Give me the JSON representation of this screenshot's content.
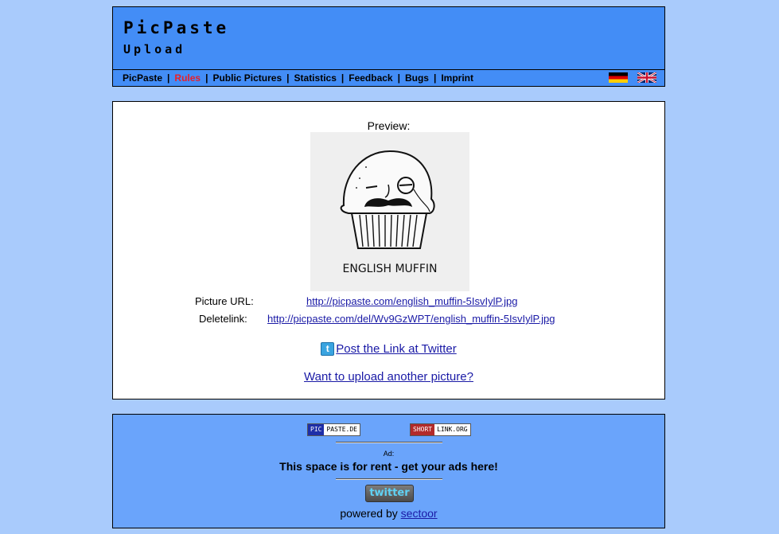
{
  "header": {
    "title": "PicPaste",
    "subtitle": "Upload"
  },
  "nav": {
    "items": [
      {
        "label": "PicPaste"
      },
      {
        "label": "Rules"
      },
      {
        "label": "Public Pictures"
      },
      {
        "label": "Statistics"
      },
      {
        "label": "Feedback"
      },
      {
        "label": "Bugs"
      },
      {
        "label": "Imprint"
      }
    ],
    "active": "Rules",
    "separator": "|"
  },
  "languages": [
    "german-flag-icon",
    "uk-flag-icon"
  ],
  "main": {
    "preview_label": "Preview:",
    "image_caption": "ENGLISH MUFFIN",
    "picture_url_label": "Picture URL:",
    "picture_url": "http://picpaste.com/english_muffin-5IsvIylP.jpg",
    "delete_label": "Deletelink:",
    "delete_url": "http://picpaste.com/del/Wv9GzWPT/english_muffin-5IsvIylP.jpg",
    "twitter_link": "Post the Link at Twitter",
    "upload_another": "Want to upload another picture?"
  },
  "footer": {
    "badge_left": {
      "part1": "PIC",
      "part2": "PASTE.DE"
    },
    "badge_right": {
      "part1": "SHORT",
      "part2": "LINK.ORG"
    },
    "ad_label": "Ad:",
    "ad_text": "This space is for rent - get your ads here!",
    "twitter_button": "twitter",
    "powered_by": "powered by",
    "powered_link": "sectoor"
  },
  "colors": {
    "page_bg": "#a9cbfc",
    "header_bg": "#438df6",
    "footer_bg": "#6aa4fb",
    "active_nav": "#e8202a",
    "link": "#1a1aa6"
  }
}
